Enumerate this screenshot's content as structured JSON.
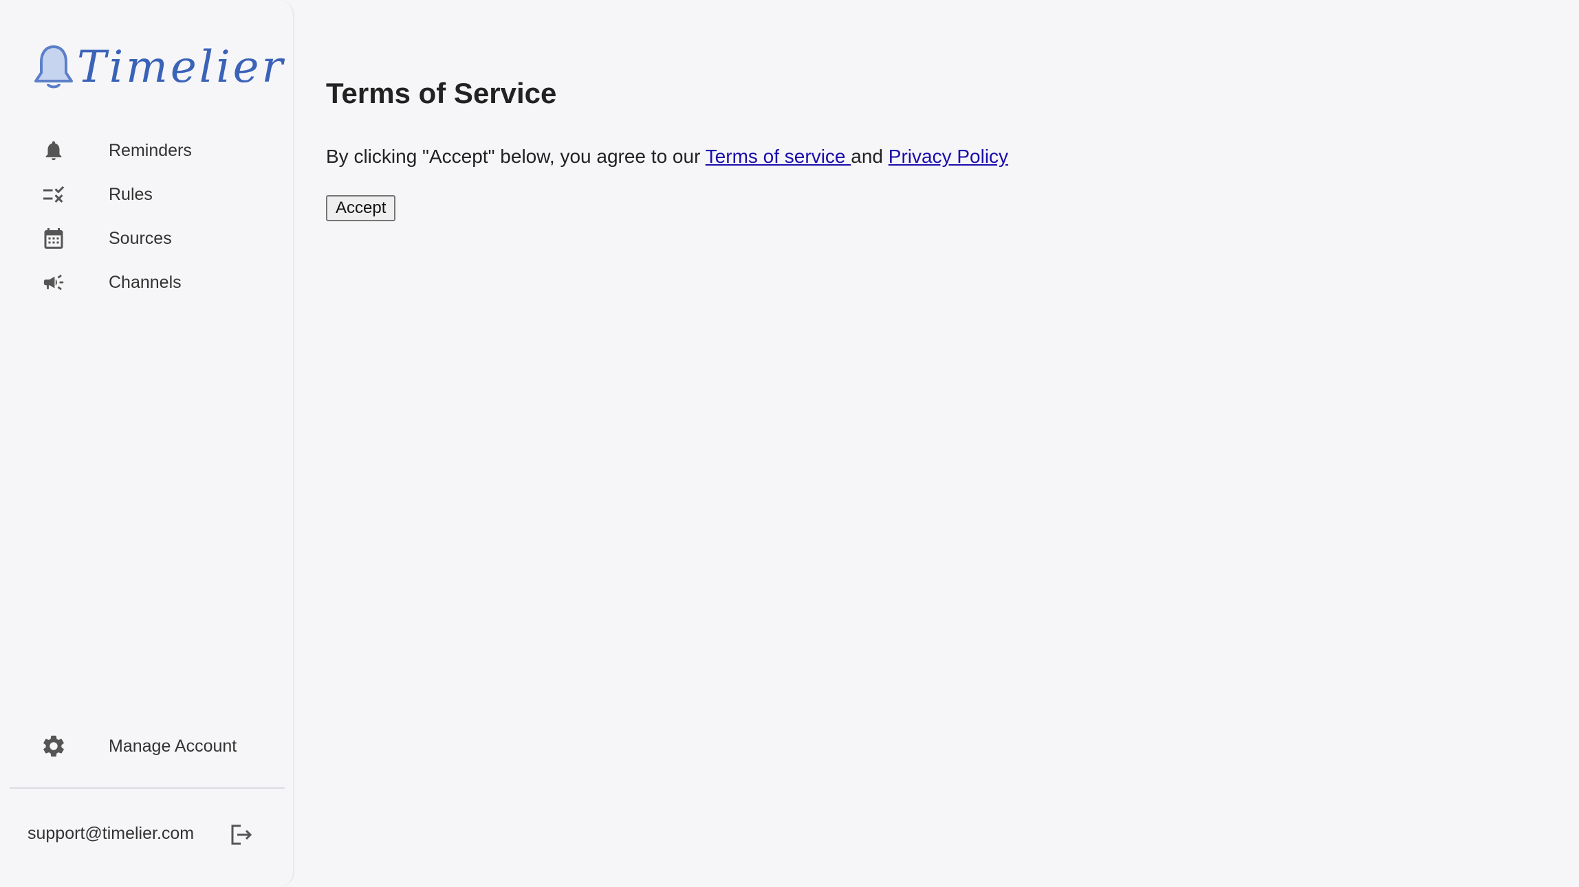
{
  "logo": {
    "text": "Timelier"
  },
  "sidebar": {
    "items": [
      {
        "label": "Reminders",
        "icon": "bell-icon"
      },
      {
        "label": "Rules",
        "icon": "rule-icon"
      },
      {
        "label": "Sources",
        "icon": "calendar-icon"
      },
      {
        "label": "Channels",
        "icon": "megaphone-icon"
      }
    ],
    "manage_account": {
      "label": "Manage Account",
      "icon": "gear-icon"
    },
    "account_email": "support@timelier.com",
    "logout_icon": "logout-icon"
  },
  "main": {
    "title": "Terms of Service",
    "agree_prefix": "By clicking \"Accept\" below, you agree to our ",
    "terms_link": "Terms of service ",
    "agree_and": "and ",
    "privacy_link": "Privacy Policy",
    "accept_label": "Accept"
  },
  "colors": {
    "background": "#f6f6f9",
    "logo_blue": "#3a63b8",
    "link": "#1a0dab",
    "icon": "#555555"
  }
}
